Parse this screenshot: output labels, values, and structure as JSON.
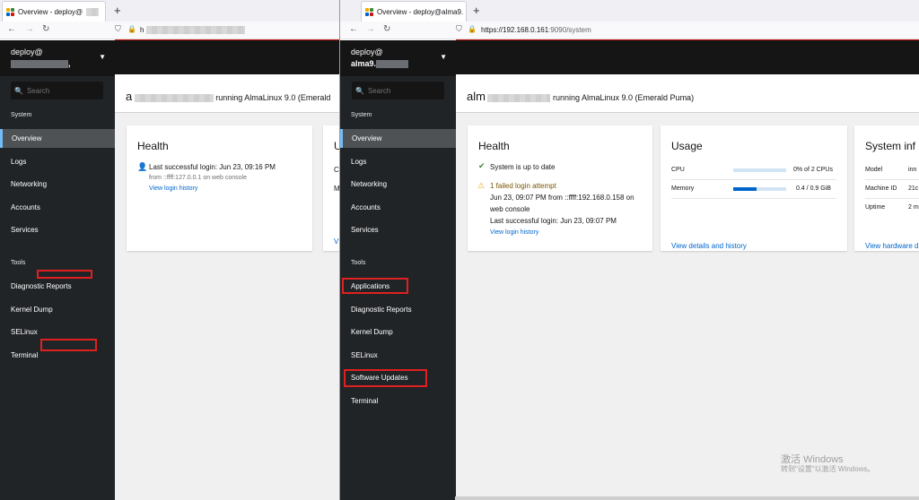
{
  "left": {
    "tab_title": "Overview - deploy@",
    "new_tab": "+",
    "url_prefix": "h",
    "host": {
      "user": "deploy@",
      "name": ""
    },
    "search_placeholder": "Search",
    "system_label": "System",
    "nav_system": [
      "Overview",
      "Logs",
      "Networking",
      "Accounts",
      "Services"
    ],
    "tools_label": "Tools",
    "nav_tools": [
      "Diagnostic Reports",
      "Kernel Dump",
      "SELinux",
      "Terminal"
    ],
    "header_prefix": "a",
    "header_running": "running AlmaLinux 9.0 (Emerald",
    "health": {
      "title": "Health",
      "last_login": "Last successful login: Jun 23, 09:16 PM",
      "from": "from ::ffff:127.0.0.1 on web console",
      "history_link": "View login history"
    },
    "usage_fragment": {
      "title": "U",
      "row1": "C",
      "row2": "M",
      "link": "V"
    }
  },
  "right": {
    "tab_title": "Overview - deploy@alma9.",
    "new_tab": "+",
    "url_host": "https://192.168.0.161",
    "url_path": ":9090/system",
    "host": {
      "user": "deploy@",
      "name": "alma9."
    },
    "search_placeholder": "Search",
    "system_label": "System",
    "nav_system": [
      "Overview",
      "Logs",
      "Networking",
      "Accounts",
      "Services"
    ],
    "tools_label": "Tools",
    "nav_tools": [
      "Applications",
      "Diagnostic Reports",
      "Kernel Dump",
      "SELinux",
      "Software Updates",
      "Terminal"
    ],
    "header_prefix": "alm",
    "header_running": "running AlmaLinux 9.0 (Emerald Puma)",
    "health": {
      "title": "Health",
      "uptodate": "System is up to date",
      "failed": "1 failed login attempt",
      "failed_detail_1": "Jun 23, 09:07 PM from ::ffff:192.168.0.158 on",
      "failed_detail_2": "web console",
      "last_login": "Last successful login: Jun 23, 09:07 PM",
      "history_link": "View login history"
    },
    "usage": {
      "title": "Usage",
      "cpu_label": "CPU",
      "cpu_value": "0% of 2 CPUs",
      "cpu_fraction": 0.0,
      "mem_label": "Memory",
      "mem_value": "0.4 / 0.9 GiB",
      "mem_fraction": 0.44,
      "link": "View details and history"
    },
    "sysinfo": {
      "title": "System inf",
      "rows": [
        {
          "label": "Model",
          "value": "inn"
        },
        {
          "label": "Machine ID",
          "value": "21c"
        },
        {
          "label": "Uptime",
          "value": "2 m"
        }
      ],
      "link": "View hardware d"
    }
  },
  "watermark": {
    "line1": "激活 Windows",
    "line2": "转到\"设置\"以激活 Windows。"
  },
  "colors": {
    "sidebar": "#212427",
    "sidebar_dark": "#151515",
    "active_item": "#4f5255",
    "active_accent": "#73bcf7",
    "link": "#0066cc",
    "highlight_box": "#e02020",
    "ok": "#3e8635",
    "warning": "#f0ab00"
  }
}
